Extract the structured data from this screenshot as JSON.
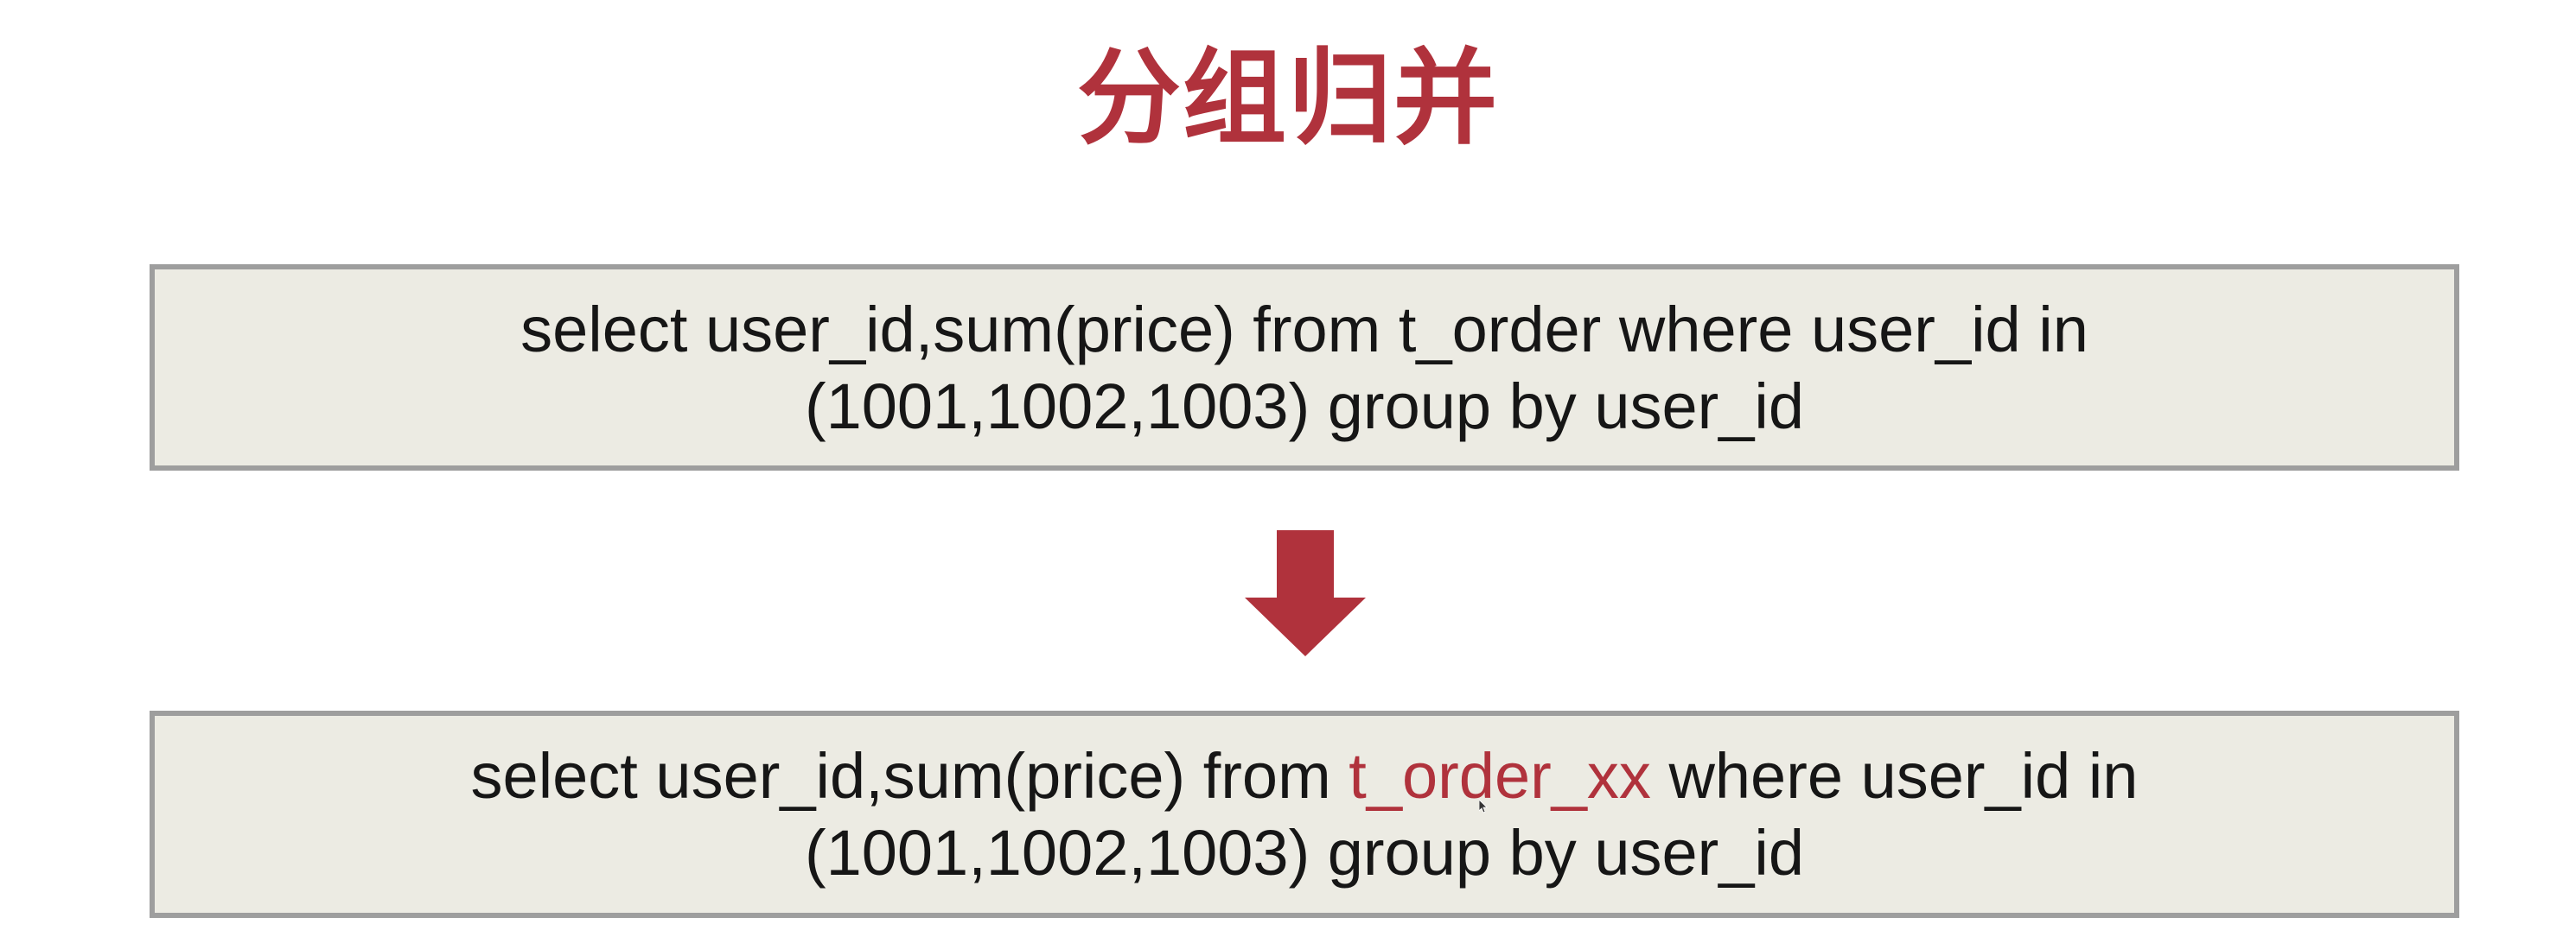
{
  "title": "分组归并",
  "colors": {
    "accent": "#b0323c",
    "box_background": "#ecebe3",
    "box_border": "#9e9e9e",
    "text": "#161616"
  },
  "original_query": {
    "line1": "select user_id,sum(price) from t_order where user_id in",
    "line2": "(1001,1002,1003) group by user_id"
  },
  "rewritten_query": {
    "line1_prefix": "select user_id,sum(price) from ",
    "line1_table": "t_order_xx",
    "line1_suffix": " where user_id in",
    "line2": "(1001,1002,1003) group by user_id"
  },
  "icons": {
    "transform_arrow": "arrow-down-icon",
    "pointer": "mouse-cursor-icon"
  }
}
